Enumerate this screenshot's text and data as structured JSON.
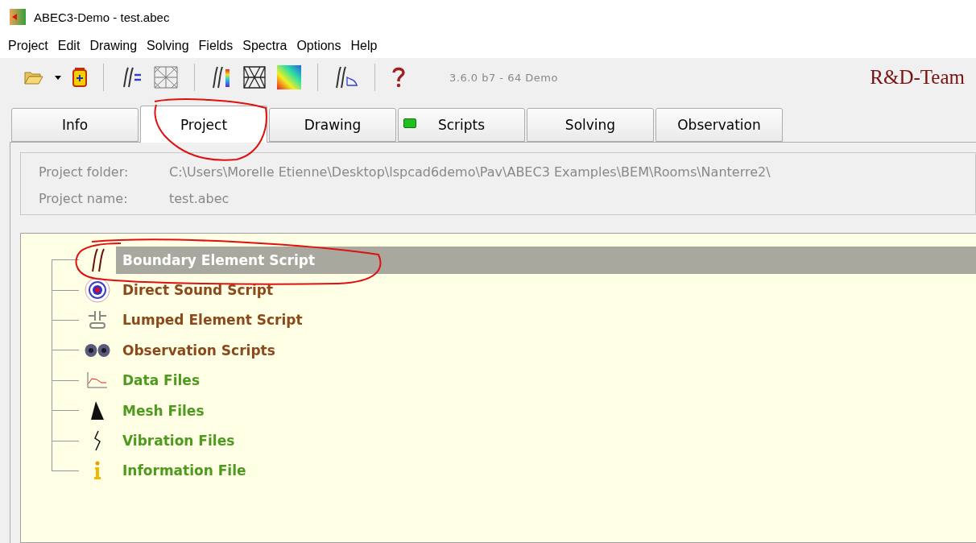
{
  "window": {
    "title": "ABEC3-Demo - test.abec"
  },
  "menu": [
    "Project",
    "Edit",
    "Drawing",
    "Solving",
    "Fields",
    "Spectra",
    "Options",
    "Help"
  ],
  "toolbar": {
    "version": "3.6.0 b7 - 64 Demo",
    "brand": "R&D-Team"
  },
  "tabs": [
    {
      "label": "Info",
      "selected": false,
      "led": false
    },
    {
      "label": "Project",
      "selected": true,
      "led": false
    },
    {
      "label": "Drawing",
      "selected": false,
      "led": false
    },
    {
      "label": "Scripts",
      "selected": false,
      "led": true
    },
    {
      "label": "Solving",
      "selected": false,
      "led": false
    },
    {
      "label": "Observation",
      "selected": false,
      "led": false
    }
  ],
  "project_info": [
    {
      "label": "Project folder:",
      "value": "C:\\Users\\Morelle Etienne\\Desktop\\lspcad6demo\\Pav\\ABEC3 Examples\\BEM\\Rooms\\Nanterre2\\"
    },
    {
      "label": "Project name:",
      "value": "test.abec"
    }
  ],
  "tree": [
    {
      "label": "Boundary Element Script",
      "kind": "bem",
      "selected": true
    },
    {
      "label": "Direct Sound Script",
      "kind": "direct",
      "selected": false,
      "color": "#8b4a1c"
    },
    {
      "label": "Lumped Element Script",
      "kind": "lumped",
      "selected": false,
      "color": "#8b4a1c"
    },
    {
      "label": "Observation Scripts",
      "kind": "observation",
      "selected": false,
      "color": "#8b4a1c"
    },
    {
      "label": "Data Files",
      "kind": "data",
      "selected": false,
      "color": "#4e9a1e"
    },
    {
      "label": "Mesh Files",
      "kind": "mesh",
      "selected": false,
      "color": "#4e9a1e"
    },
    {
      "label": "Vibration Files",
      "kind": "vibration",
      "selected": false,
      "color": "#4e9a1e"
    },
    {
      "label": "Information File",
      "kind": "info",
      "selected": false,
      "color": "#4e9a1e"
    }
  ]
}
